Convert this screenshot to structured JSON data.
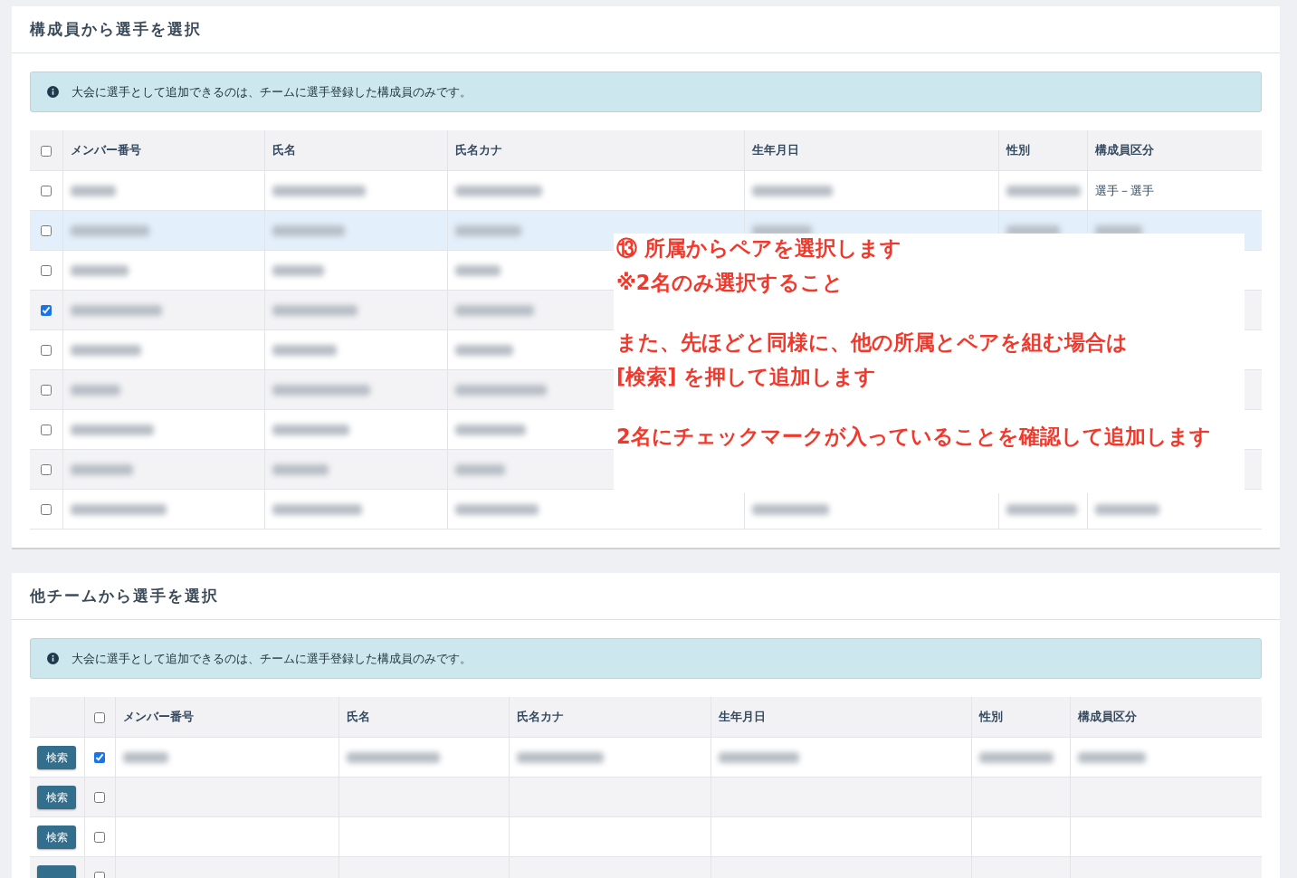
{
  "sections": [
    {
      "title": "構成員から選手を選択",
      "info": "大会に選手として追加できるのは、チームに選手登録した構成員のみです。",
      "header_checked": false,
      "columns": [
        "メンバー番号",
        "氏名",
        "氏名カナ",
        "生年月日",
        "性別",
        "構成員区分"
      ],
      "rows": [
        {
          "checked": false,
          "highlighted": false,
          "cells": [
            {
              "kind": "blurred"
            },
            {
              "kind": "blurred"
            },
            {
              "kind": "blurred"
            },
            {
              "kind": "blurred"
            },
            {
              "kind": "blurred"
            },
            {
              "kind": "text",
              "text": "選手－選手"
            }
          ]
        },
        {
          "checked": false,
          "highlighted": true,
          "cells": [
            {
              "kind": "blurred"
            },
            {
              "kind": "blurred"
            },
            {
              "kind": "blurred"
            },
            {
              "kind": "blurred"
            },
            {
              "kind": "blurred"
            },
            {
              "kind": "blurred"
            }
          ]
        },
        {
          "checked": false,
          "highlighted": false,
          "cells": [
            {
              "kind": "blurred"
            },
            {
              "kind": "blurred"
            },
            {
              "kind": "blurred"
            }
          ]
        },
        {
          "checked": true,
          "highlighted": false,
          "cells": [
            {
              "kind": "blurred"
            },
            {
              "kind": "blurred"
            },
            {
              "kind": "blurred"
            }
          ]
        },
        {
          "checked": false,
          "highlighted": false,
          "cells": [
            {
              "kind": "blurred"
            },
            {
              "kind": "blurred"
            },
            {
              "kind": "blurred"
            }
          ]
        },
        {
          "checked": false,
          "highlighted": false,
          "cells": [
            {
              "kind": "blurred"
            },
            {
              "kind": "blurred"
            },
            {
              "kind": "blurred"
            }
          ]
        },
        {
          "checked": false,
          "highlighted": false,
          "cells": [
            {
              "kind": "blurred"
            },
            {
              "kind": "blurred"
            },
            {
              "kind": "blurred"
            }
          ]
        },
        {
          "checked": false,
          "highlighted": false,
          "cells": [
            {
              "kind": "blurred"
            },
            {
              "kind": "blurred"
            },
            {
              "kind": "blurred"
            }
          ]
        },
        {
          "checked": false,
          "highlighted": false,
          "cells": [
            {
              "kind": "blurred"
            },
            {
              "kind": "blurred"
            },
            {
              "kind": "blurred"
            },
            {
              "kind": "blurred"
            },
            {
              "kind": "blurred"
            },
            {
              "kind": "blurred"
            }
          ]
        }
      ],
      "annotation": {
        "paragraphs": [
          [
            "⑬ 所属からペアを選択します",
            "※2名のみ選択すること"
          ],
          [
            "また、先ほどと同様に、他の所属とペアを組む場合は",
            "[検索] を押して追加します"
          ],
          [
            "2名にチェックマークが入っていることを確認して追加します"
          ]
        ]
      }
    },
    {
      "title": "他チームから選手を選択",
      "info": "大会に選手として追加できるのは、チームに選手登録した構成員のみです。",
      "header_checked": false,
      "columns": [
        "メンバー番号",
        "氏名",
        "氏名カナ",
        "生年月日",
        "性別",
        "構成員区分"
      ],
      "rows": [
        {
          "kind": "search",
          "checked": true,
          "button": "検索",
          "cells": [
            {
              "kind": "blurred"
            },
            {
              "kind": "blurred"
            },
            {
              "kind": "blurred"
            },
            {
              "kind": "blurred"
            },
            {
              "kind": "blurred"
            },
            {
              "kind": "blurred"
            }
          ]
        },
        {
          "kind": "search",
          "checked": false,
          "button": "検索",
          "cells": []
        },
        {
          "kind": "search",
          "checked": false,
          "button": "検索",
          "cells": []
        },
        {
          "kind": "search",
          "checked": false,
          "cells": []
        }
      ]
    }
  ]
}
